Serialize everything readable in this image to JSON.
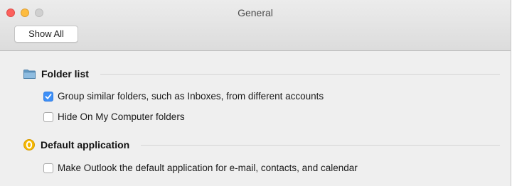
{
  "window": {
    "title": "General",
    "show_all_label": "Show All"
  },
  "sections": [
    {
      "heading": "Folder list",
      "icon": "folder-icon",
      "options": [
        {
          "label": "Group similar folders, such as Inboxes, from different accounts",
          "checked": true
        },
        {
          "label": "Hide On My Computer folders",
          "checked": false
        }
      ]
    },
    {
      "heading": "Default application",
      "icon": "outlook-icon",
      "options": [
        {
          "label": "Make Outlook the default application for e-mail, contacts, and calendar",
          "checked": false
        }
      ]
    }
  ],
  "colors": {
    "checkbox_checked": "#3d8ff7",
    "close": "#fc605c",
    "minimize": "#fdbc40",
    "zoom_disabled": "#d0d0d0",
    "outlook_badge": "#f5b800"
  }
}
